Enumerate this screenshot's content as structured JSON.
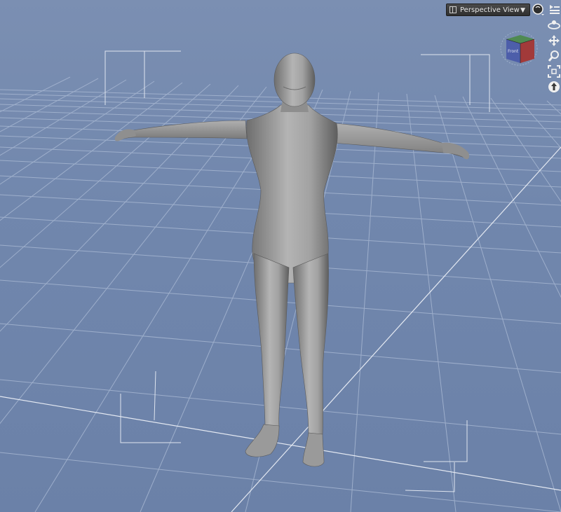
{
  "viewport": {
    "view_label": "Perspective View",
    "cube_face_label": "Front",
    "colors": {
      "background": "#7187ad",
      "grid": "#a9b9d3",
      "figure": "#8c8c8c",
      "toolbar": "#3a3a3a"
    }
  },
  "toolbar_icons": [
    "shading-icon",
    "menu-icon",
    "orbit-icon",
    "pan-icon",
    "zoom-icon",
    "frame-icon",
    "reset-icon"
  ]
}
